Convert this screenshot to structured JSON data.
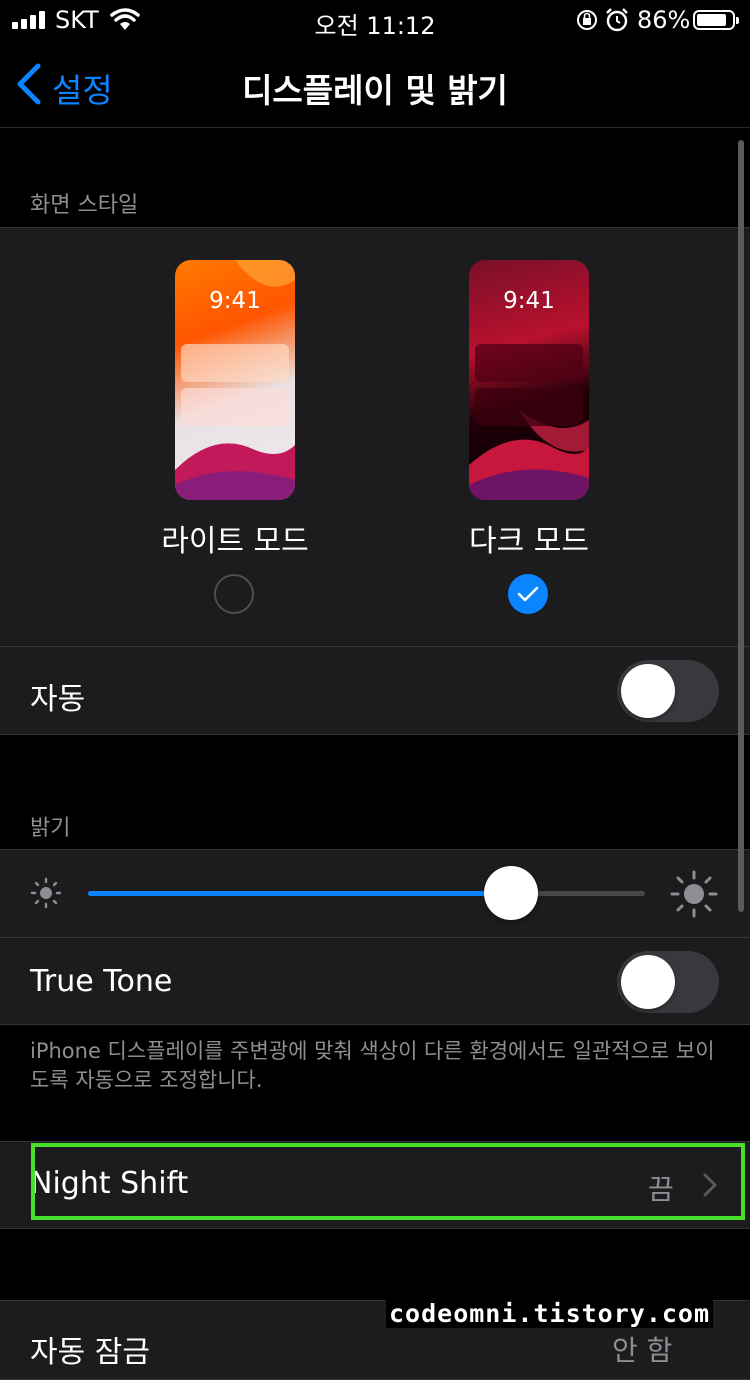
{
  "status_bar": {
    "carrier": "SKT",
    "time": "오전 11:12",
    "battery_percent": "86%",
    "battery_level": 0.86
  },
  "nav": {
    "back_label": "설정",
    "title": "디스플레이 및 밝기"
  },
  "appearance": {
    "header": "화면 스타일",
    "light": {
      "label": "라이트 모드",
      "time": "9:41",
      "selected": false
    },
    "dark": {
      "label": "다크 모드",
      "time": "9:41",
      "selected": true
    },
    "automatic": {
      "label": "자동",
      "on": false
    }
  },
  "brightness": {
    "header": "밝기",
    "level": 0.76,
    "true_tone": {
      "label": "True Tone",
      "on": false
    },
    "footer": "iPhone 디스플레이를 주변광에 맞춰 색상이 다른 환경에서도 일관적으로 보이도록 자동으로 조정합니다."
  },
  "night_shift": {
    "label": "Night Shift",
    "value": "끔"
  },
  "partial_row": {
    "label": "자동 잠금",
    "value": "안 함"
  },
  "watermark": "codeomni.tistory.com",
  "colors": {
    "accent": "#0a84ff",
    "background": "#000000",
    "cell": "#1c1c1e",
    "highlight_box": "#48e02a"
  }
}
